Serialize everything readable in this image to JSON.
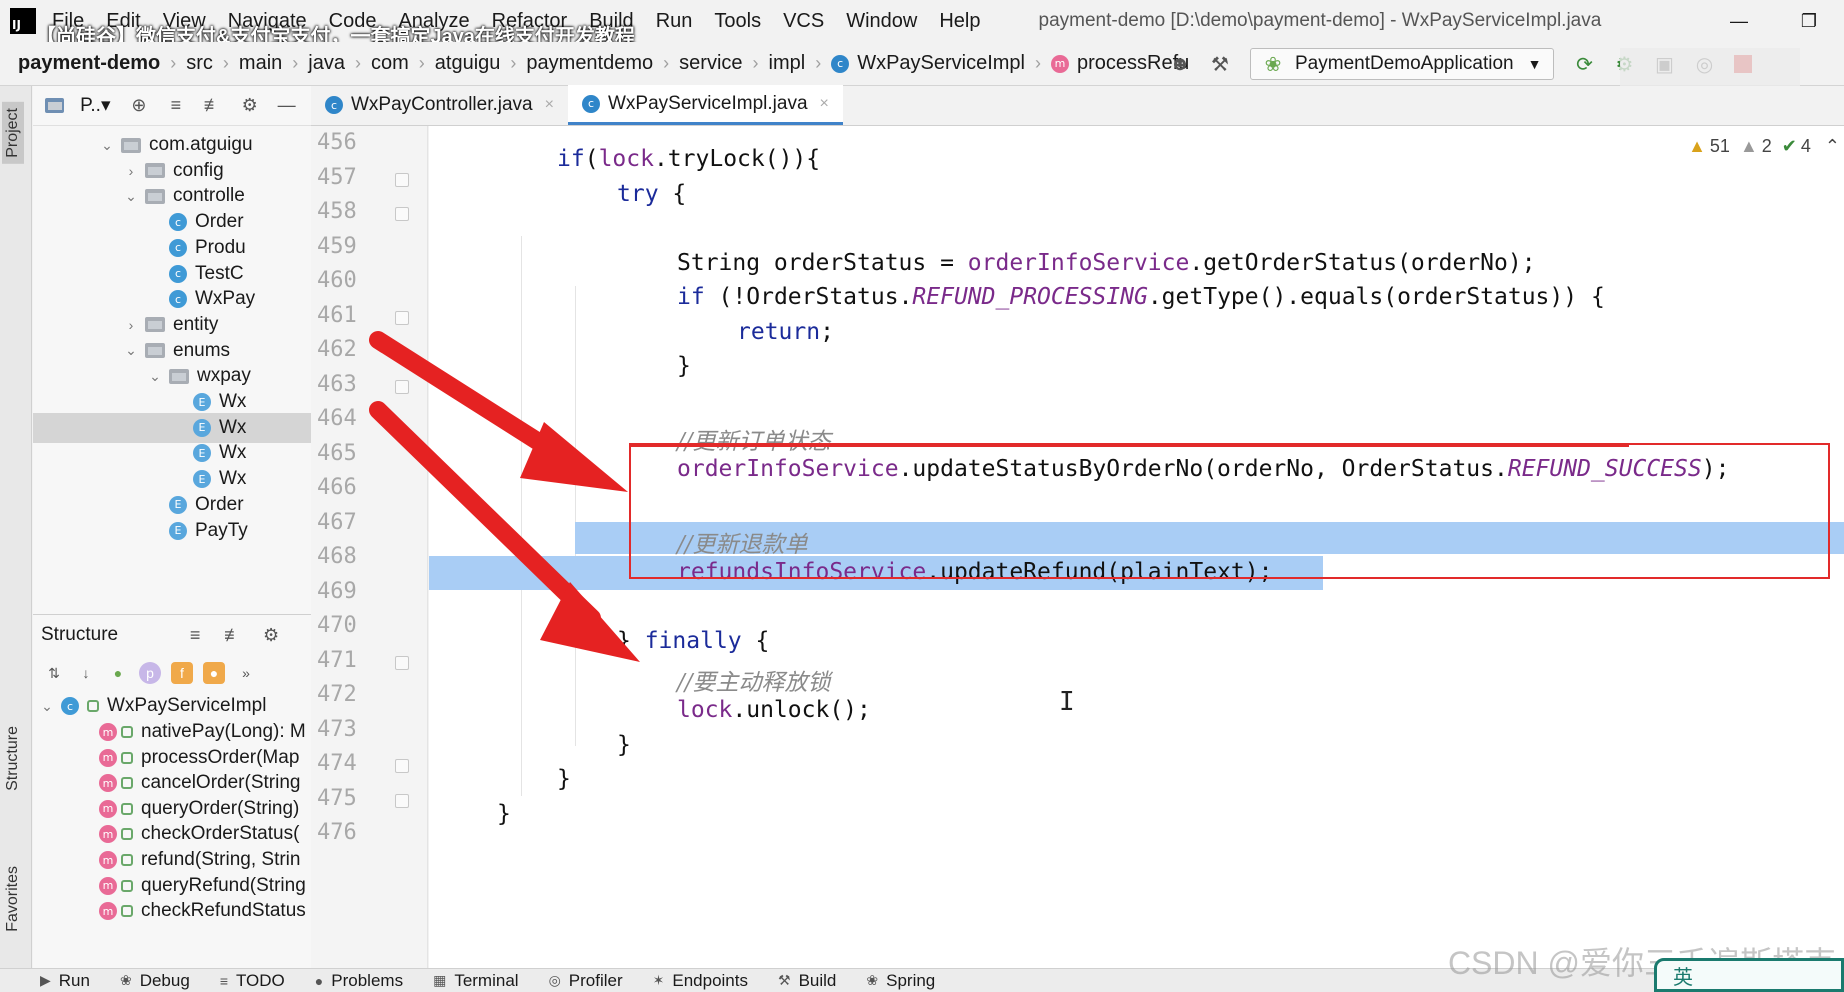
{
  "menu": {
    "items": [
      "File",
      "Edit",
      "View",
      "Navigate",
      "Code",
      "Analyze",
      "Refactor",
      "Build",
      "Run",
      "Tools",
      "VCS",
      "Window",
      "Help"
    ],
    "window_title": "payment-demo [D:\\demo\\payment-demo] - WxPayServiceImpl.java",
    "overlay_title": "【尚硅谷】微信支付&支付宝支付，一套搞定Java在线支付开发教程"
  },
  "breadcrumbs": [
    "payment-demo",
    "src",
    "main",
    "java",
    "com",
    "atguigu",
    "paymentdemo",
    "service",
    "impl",
    "WxPayServiceImpl",
    "processRefu"
  ],
  "run_config": "PaymentDemoApplication",
  "project_panel": {
    "title": "P..▾",
    "tree": [
      {
        "label": "com.atguigu",
        "kind": "folder",
        "depth": 0,
        "arrow": "v"
      },
      {
        "label": "config",
        "kind": "folder",
        "depth": 1,
        "arrow": ">"
      },
      {
        "label": "controlle",
        "kind": "folder",
        "depth": 1,
        "arrow": "v"
      },
      {
        "label": "Order",
        "kind": "class",
        "depth": 2,
        "arrow": ""
      },
      {
        "label": "Produ",
        "kind": "class",
        "depth": 2,
        "arrow": ""
      },
      {
        "label": "TestC",
        "kind": "class",
        "depth": 2,
        "arrow": ""
      },
      {
        "label": "WxPay",
        "kind": "class",
        "depth": 2,
        "arrow": ""
      },
      {
        "label": "entity",
        "kind": "folder",
        "depth": 1,
        "arrow": ">"
      },
      {
        "label": "enums",
        "kind": "folder",
        "depth": 1,
        "arrow": "v"
      },
      {
        "label": "wxpay",
        "kind": "folder",
        "depth": 2,
        "arrow": "v"
      },
      {
        "label": "Wx",
        "kind": "enum",
        "depth": 3,
        "arrow": ""
      },
      {
        "label": "Wx",
        "kind": "enum",
        "depth": 3,
        "arrow": "",
        "selected": true
      },
      {
        "label": "Wx",
        "kind": "enum",
        "depth": 3,
        "arrow": ""
      },
      {
        "label": "Wx",
        "kind": "enum",
        "depth": 3,
        "arrow": ""
      },
      {
        "label": "Order",
        "kind": "enum",
        "depth": 2,
        "arrow": ""
      },
      {
        "label": "PayTy",
        "kind": "enum",
        "depth": 2,
        "arrow": ""
      }
    ]
  },
  "structure_panel": {
    "title": "Structure",
    "root": "WxPayServiceImpl",
    "methods": [
      "nativePay(Long): M",
      "processOrder(Map",
      "cancelOrder(String",
      "queryOrder(String)",
      "checkOrderStatus(",
      "refund(String, Strin",
      "queryRefund(String",
      "checkRefundStatus"
    ]
  },
  "editor": {
    "tabs": [
      {
        "label": "WxPayController.java",
        "active": false
      },
      {
        "label": "WxPayServiceImpl.java",
        "active": true
      }
    ],
    "inspections": {
      "warnings": "51",
      "weak": "2",
      "typos": "4"
    },
    "line_numbers": [
      "456",
      "457",
      "458",
      "459",
      "460",
      "461",
      "462",
      "463",
      "464",
      "465",
      "466",
      "467",
      "468",
      "469",
      "470",
      "471",
      "472",
      "473",
      "474",
      "475",
      "476"
    ],
    "code": {
      "l457_if": "if",
      "l457_lock": "lock",
      "l457_rest": ".tryLock()){",
      "l458_try": "try",
      "l458_brace": " {",
      "l460_a": "String orderStatus = ",
      "l460_field": "orderInfoService",
      "l460_b": ".getOrderStatus(orderNo);",
      "l461_if": "if",
      "l461_a": " (!OrderStatus.",
      "l461_const": "REFUND_PROCESSING",
      "l461_b": ".getType().equals(orderStatus)) {",
      "l462_return": "return",
      "l462_semi": ";",
      "l463": "}",
      "l465_comment": "//更新订单状态",
      "l466_field": "orderInfoService",
      "l466_a": ".updateStatusByOrderNo(orderNo, OrderStatus.",
      "l466_const": "REFUND_SUCCESS",
      "l466_b": ");",
      "l468_comment": "//更新退款单",
      "l469_field": "refundsInfoService",
      "l469_a": ".updateRefund(plainText);",
      "l471_a": "} ",
      "l471_finally": "finally",
      "l471_b": " {",
      "l472_comment": "//要主动释放锁",
      "l473_field": "lock",
      "l473_a": ".unlock();",
      "l474": "}",
      "l475": "}",
      "l476": "}"
    }
  },
  "bottom_tools": [
    "Run",
    "Debug",
    "TODO",
    "Problems",
    "Terminal",
    "Profiler",
    "Endpoints",
    "Build",
    "Spring"
  ],
  "side_tabs": {
    "project": "Project",
    "structure": "Structure",
    "favorites": "Favorites"
  },
  "watermark": "CSDN @爱你三千遍斯塔克",
  "ime_label": "英",
  "colors": {
    "selection": "#a9cdf5",
    "annotation_red": "#e22a2a",
    "keyword": "#1b2b9a",
    "field": "#7a2a8a",
    "comment": "#8a8a8a"
  }
}
